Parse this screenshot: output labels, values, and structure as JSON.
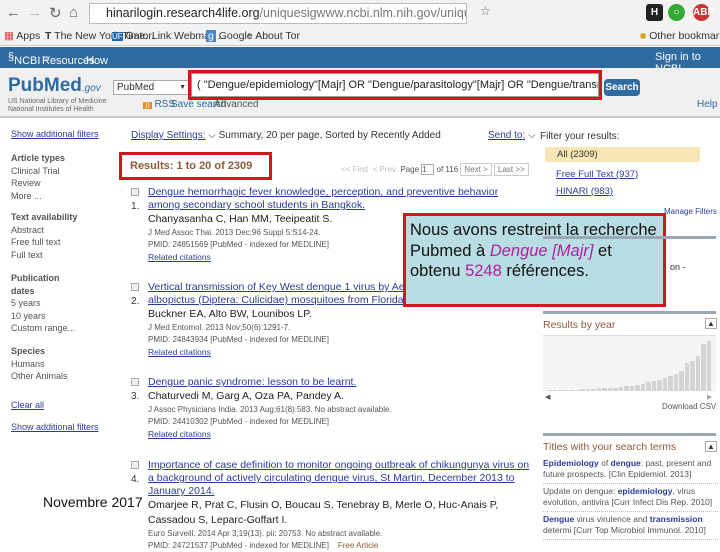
{
  "browser": {
    "url_host": "hinarilogin.research4life.org",
    "url_path": "/uniquesigwww.ncbi.nlm.nih.gov/uniquesig0/pubmed?term=(+\"Dengue",
    "bookmarks": [
      "Apps",
      "The New York Time...",
      "GatorLink Webmail ...",
      "Google",
      "About Tor",
      "Other bookmarks"
    ]
  },
  "ncbi": {
    "brand": "NCBI",
    "resources": "Resources",
    "howto": "How To",
    "signin": "Sign in to NCBI"
  },
  "pubmed": {
    "logo": "PubMed",
    "logo_suffix": ".gov",
    "logo_sub1": "US National Library of Medicine",
    "logo_sub2": "National Institutes of Health",
    "database": "PubMed",
    "query": "( \"Dengue/epidemiology\"[Majr] OR \"Dengue/parasitology\"[Majr] OR \"Dengue/transmission",
    "search": "Search",
    "rss": "RSS",
    "save_search": "Save search",
    "advanced": "Advanced",
    "help": "Help"
  },
  "sidebar": {
    "show_filters": "Show additional filters",
    "article_types": "Article types",
    "at_items": [
      "Clinical Trial",
      "Review",
      "More ..."
    ],
    "text_avail": "Text availability",
    "ta_items": [
      "Abstract",
      "Free full text",
      "Full text"
    ],
    "pub_dates": "Publication dates",
    "pd_items": [
      "5 years",
      "10 years",
      "Custom range..."
    ],
    "species": "Species",
    "sp_items": [
      "Humans",
      "Other Animals"
    ],
    "clear_all": "Clear all",
    "show_filters2": "Show additional filters"
  },
  "main": {
    "display_settings": "Display Settings:",
    "display_value": "Summary, 20 per page, Sorted by Recently Added",
    "send_to": "Send to:",
    "results": "Results: 1 to 20 of 2309",
    "first": "<< First",
    "prev": "< Prev",
    "page_label": "Page",
    "page": "1",
    "of": "of 116",
    "next": "Next >",
    "last": "Last >>",
    "items": [
      {
        "num": "1.",
        "title": "Dengue hemorrhagic fever knowledge, perception, and preventive behavior among secondary school students in Bangkok.",
        "authors": "Chanyasanha C, Han MM, Teeipeatit S.",
        "source": "J Med Assoc Thai. 2013 Dec;96 Suppl 5:S14-24.",
        "pmid": "PMID: 24851569 [PubMed - indexed for MEDLINE]",
        "related": "Related citations"
      },
      {
        "num": "2.",
        "title": "Vertical transmission of Key West dengue 1 virus by Aedes aegypti and Aedes albopictus (Diptera: Culicidae) mosquitoes from Florida.",
        "authors": "Buckner EA, Alto BW, Lounibos LP.",
        "source": "J Med Entomol. 2013 Nov;50(6):1291-7.",
        "pmid": "PMID: 24843934 [PubMed - indexed for MEDLINE]",
        "related": "Related citations"
      },
      {
        "num": "3.",
        "title": "Dengue panic syndrome: lesson to be learnt.",
        "authors": "Chaturvedi M, Garg A, Oza PA, Pandey A.",
        "source": "J Assoc Physicians India. 2013 Aug;61(8):583. No abstract available.",
        "pmid": "PMID: 24410302 [PubMed - indexed for MEDLINE]",
        "related": "Related citations"
      },
      {
        "num": "4.",
        "title": "Importance of case definition to monitor ongoing outbreak of chikungunya virus on a background of actively circulating dengue virus, St Martin, December 2013 to January 2014.",
        "authors": "Omarjee R, Prat C, Flusin O, Boucau S, Tenebray B, Merle O, Huc-Anais P, Cassadou S, Leparc-Goffart I.",
        "source": "Euro Surveill. 2014 Apr 3;19(13). pii: 20753. No abstract available.",
        "pmid": "PMID: 24721537 [PubMed - indexed for MEDLINE]",
        "free": "Free Article"
      }
    ]
  },
  "right": {
    "filter_title": "Filter your results:",
    "filters": [
      "All (2309)",
      "Free Full Text (937)",
      "HINARI (983)"
    ],
    "manage": "Manage Filters",
    "partial": "on -",
    "by_year": "Results by year",
    "download": "Download CSV",
    "year_bars": [
      2,
      2,
      2,
      2,
      2,
      2,
      3,
      3,
      3,
      4,
      4,
      5,
      5,
      6,
      7,
      8,
      9,
      11,
      13,
      15,
      17,
      19,
      23,
      26,
      30,
      42,
      45,
      52,
      70,
      75
    ],
    "titles_head": "Titles with your search terms",
    "titles": [
      {
        "b": "Epidemiology",
        "t1": " of ",
        "b2": "dengue",
        "t2": ": past, present and future prospects.",
        "src": "[Clin Epidemiol. 2013]"
      },
      {
        "b": "",
        "t1": "Update on dengue: ",
        "b2": "epidemiology",
        "t2": ", virus evolution, antivira",
        "src": "[Curr Infect Dis Rep. 2010]"
      },
      {
        "b": "Dengue",
        "t1": " virus virulence and ",
        "b2": "transmission",
        "t2": " determi",
        "src": "[Curr Top Microbiol Immunol. 2010]"
      }
    ]
  },
  "callout": {
    "t1": "Nous avons restreint la recherche Pubmed à ",
    "em1": "Dengue [Majr]",
    "t2": " et obtenu ",
    "num": "5248",
    "t3": " références."
  },
  "footer": {
    "date": "Novembre 2017"
  },
  "colors": {
    "ncbi_blue": "#2f6aa0",
    "highlight_red": "#d0171c",
    "callout_bg": "#b8dde3",
    "magenta": "#b0219e",
    "link": "#2b3c99"
  }
}
